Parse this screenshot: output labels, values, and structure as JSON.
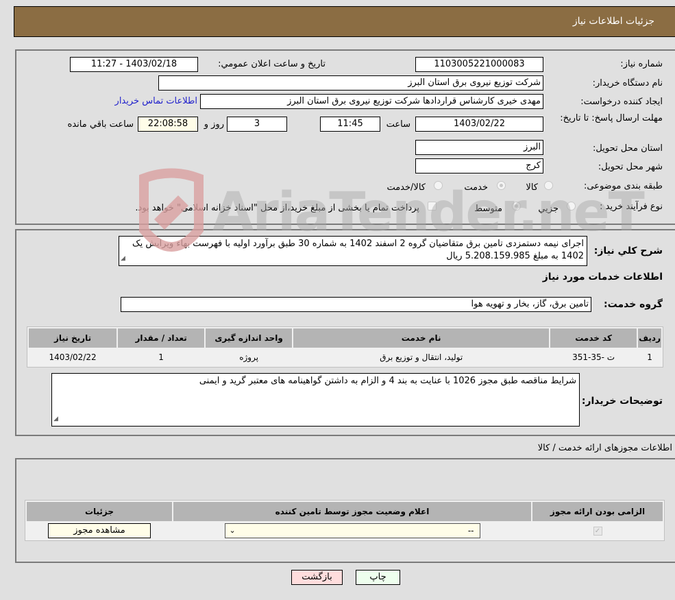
{
  "header": {
    "title": "جزئیات اطلاعات نیاز"
  },
  "details": {
    "need_number_label": "شماره نیاز:",
    "need_number": "1103005221000083",
    "announce_label": "تاریخ و ساعت اعلان عمومي:",
    "announce_value": "1403/02/18 - 11:27",
    "buyer_org_label": "نام دستگاه خریدار:",
    "buyer_org": "شرکت توزیع نیروی برق استان البرز",
    "creator_label": "ایجاد کننده درخواست:",
    "creator": "مهدی خیری کارشناس قراردادها شرکت توزیع نیروی برق استان البرز",
    "contact_link": "اطلاعات تماس خریدار",
    "deadline_label": "مهلت ارسال پاسخ: تا تاریخ:",
    "deadline_date": "1403/02/22",
    "time_label": "ساعت",
    "deadline_time": "11:45",
    "days_value": "3",
    "days_label": "روز و",
    "remaining_time": "22:08:58",
    "remaining_label": "ساعت باقي مانده",
    "province_label": "استان محل تحویل:",
    "province": "البرز",
    "city_label": "شهر محل تحویل:",
    "city": "کرج",
    "category_label": "طبقه بندی موضوعی:",
    "category_options": [
      "کالا",
      "خدمت",
      "کالا/خدمت"
    ],
    "category_selected": "خدمت",
    "process_label": "نوع فرآیند خرید :",
    "process_options": [
      "جزيي",
      "متوسط"
    ],
    "process_selected": "متوسط",
    "treasury_note": "پرداخت تمام یا بخشی از مبلغ خرید،از محل \"اسناد خزانه اسلامی\" خواهد بود."
  },
  "description": {
    "label": "شرح کلي نیاز:",
    "text": "اجرای نیمه دستمزدی تامین برق متقاضیان گروه 2 اسفند 1402 به شماره 30 طبق برآورد اولیه با فهرست بهاء ویرایش یک 1402 به مبلغ 5.208.159.985 ریال",
    "services_title": "اطلاعات خدمات مورد نیاز",
    "service_group_label": "گروه خدمت:",
    "service_group": "تامین برق، گاز، بخار و تهویه هوا"
  },
  "services_table": {
    "headers": [
      "ردیف",
      "کد خدمت",
      "نام خدمت",
      "واحد اندازه گیری",
      "تعداد / مقدار",
      "تاریخ نیاز"
    ],
    "rows": [
      [
        "1",
        "ت -35-351",
        "تولید، انتقال و توزیع برق",
        "پروژه",
        "1",
        "1403/02/22"
      ]
    ]
  },
  "buyer_notes": {
    "label": "توضیحات خریدار:",
    "text": "شرایط مناقصه طبق مجوز 1026 با عنایت به بند 4 و الزام به داشتن گواهینامه های معتبر گرید و ایمنی"
  },
  "permits": {
    "title": "اطلاعات مجوزهای ارائه خدمت / کالا",
    "headers": [
      "الزامی بودن ارائه مجوز",
      "اعلام وضعیت مجوز توسط تامین کننده",
      "جزئیات"
    ],
    "required_checked": true,
    "status_select_value": "--",
    "view_button": "مشاهده مجوز"
  },
  "footer": {
    "print_button": "چاپ",
    "back_button": "بازگشت"
  },
  "watermark": {
    "text": "AriaTender.neT"
  }
}
